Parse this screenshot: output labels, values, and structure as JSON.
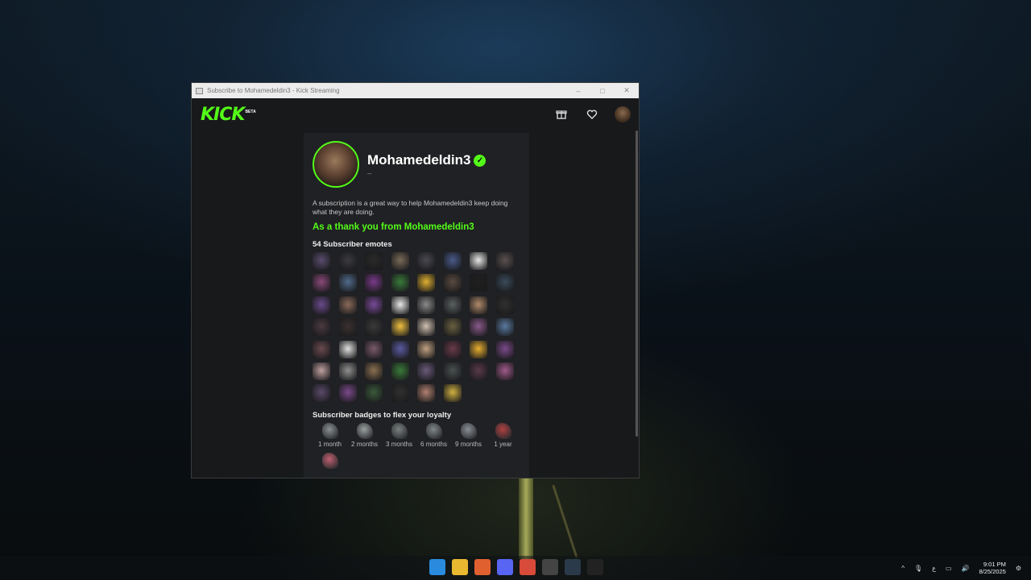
{
  "window": {
    "title": "Subscribe to Mohamedeldin3 - Kick Streaming",
    "controls": [
      "–",
      "□",
      "✕"
    ]
  },
  "header": {
    "logo": "KICK",
    "beta": "BETA",
    "icons": [
      "gift-icon",
      "heart-icon",
      "user-avatar"
    ]
  },
  "profile": {
    "name": "Mohamedeldin3",
    "subline": "--",
    "verified": true
  },
  "description": "A subscription is a great way to help Mohamedeldin3 keep doing what they are doing.",
  "thanks_heading": "As a thank you from Mohamedeldin3",
  "emotes": {
    "title": "54 Subscriber emotes",
    "colors": [
      "#5a4c6e",
      "#3a3a40",
      "#2a2a2a",
      "#7a6a58",
      "#4a4850",
      "#4a5a8a",
      "#e8e8e8",
      "#5a5050",
      "#8a4a7a",
      "#506a8a",
      "#7a3a8a",
      "#3a7a3a",
      "#e0b030",
      "#5a4a40",
      "#202020",
      "#3a4a5a",
      "#6a4a8a",
      "#8a6a5a",
      "#7a4a9a",
      "#e8e8e8",
      "#8a8a8a",
      "#5a6060",
      "#b08a6a",
      "#303030",
      "#4a3a40",
      "#3a3030",
      "#3a3a3a",
      "#f0c040",
      "#d0c0b0",
      "#6a6040",
      "#8a5a8a",
      "#5a7aa0",
      "#6a4a50",
      "#e0e0e0",
      "#7a5a6a",
      "#5a5aa0",
      "#c0a080",
      "#6a3a4a",
      "#e8b030",
      "#7a4a8a",
      "#c0a0a0",
      "#909090",
      "#8a7050",
      "#3a7a3a",
      "#6a5a7a",
      "#4a5050",
      "#5a3a4a",
      "#a05a8a",
      "#5a4a6a",
      "#7a4a8a",
      "#3a5a3a",
      "#303030",
      "#b08070",
      "#d0b040"
    ]
  },
  "badges": {
    "title": "Subscriber badges to flex your loyalty",
    "items": [
      {
        "label": "1 month",
        "color": "#8a9090"
      },
      {
        "label": "2 months",
        "color": "#9aa0a0"
      },
      {
        "label": "3 months",
        "color": "#7a8080"
      },
      {
        "label": "6 months",
        "color": "#808888"
      },
      {
        "label": "9 months",
        "color": "#8a9096"
      },
      {
        "label": "1 year",
        "color": "#b04040"
      },
      {
        "label": "",
        "color": "#c06070"
      }
    ]
  },
  "taskbar": {
    "apps": [
      "windows-start",
      "file-explorer",
      "artstation",
      "discord",
      "chrome",
      "obs",
      "steam",
      "epic-games"
    ],
    "tray": {
      "chevron": "^",
      "lang": "ع",
      "time": "9:01 PM",
      "date": "8/25/2025"
    }
  }
}
